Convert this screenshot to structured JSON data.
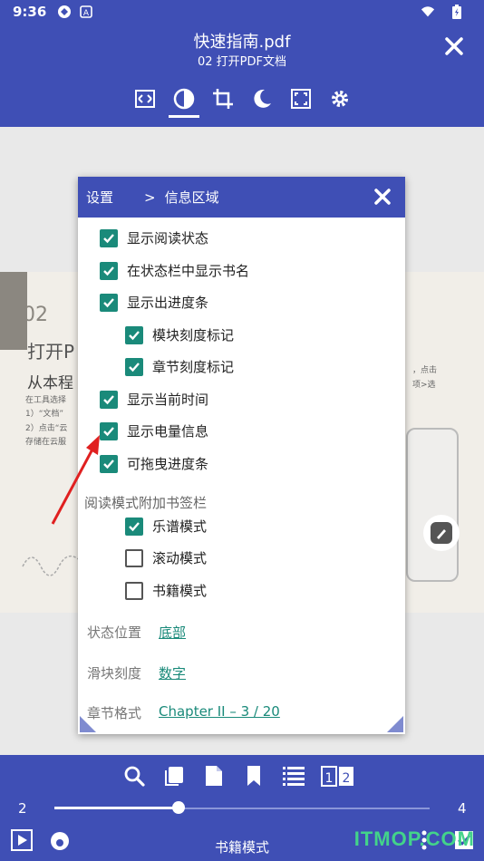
{
  "status": {
    "time": "9:36"
  },
  "appbar": {
    "title": "快速指南.pdf",
    "subtitle": "02 打开PDF文档"
  },
  "doc": {
    "num": "02",
    "heading": "打开P",
    "line": "从本程",
    "small1": "在工具选择",
    "small2": "1）“文档”",
    "small3": "2）点击“云",
    "small4": "存储在云服",
    "small5": "，点击",
    "small6": "项>选"
  },
  "dialog": {
    "head_settings": "设置",
    "head_sep": ">",
    "head_title": "信息区域",
    "items": [
      {
        "label": "显示阅读状态",
        "checked": true
      },
      {
        "label": "在状态栏中显示书名",
        "checked": true
      },
      {
        "label": "显示出进度条",
        "checked": true
      },
      {
        "label": "模块刻度标记",
        "checked": true
      },
      {
        "label": "章节刻度标记",
        "checked": true
      },
      {
        "label": "显示当前时间",
        "checked": true
      },
      {
        "label": "显示电量信息",
        "checked": true
      },
      {
        "label": "可拖曳进度条",
        "checked": true
      }
    ],
    "section": "阅读模式附加书签栏",
    "modes": [
      {
        "label": "乐谱模式",
        "checked": true
      },
      {
        "label": "滚动模式",
        "checked": false
      },
      {
        "label": "书籍模式",
        "checked": false
      }
    ],
    "props": [
      {
        "key": "状态位置",
        "value": "底部"
      },
      {
        "key": "滑块刻度",
        "value": "数字"
      },
      {
        "key": "章节格式",
        "value": "Chapter II – 3 / 20"
      }
    ]
  },
  "bottom": {
    "page_start": "2",
    "page_end": "4",
    "progress": 0.33,
    "mode_label": "书籍模式",
    "watermark": "ITMOP.COM"
  },
  "colors": {
    "primary": "#3f4fb5",
    "checkbox": "#1a8a7a",
    "arrow": "#e02020"
  }
}
